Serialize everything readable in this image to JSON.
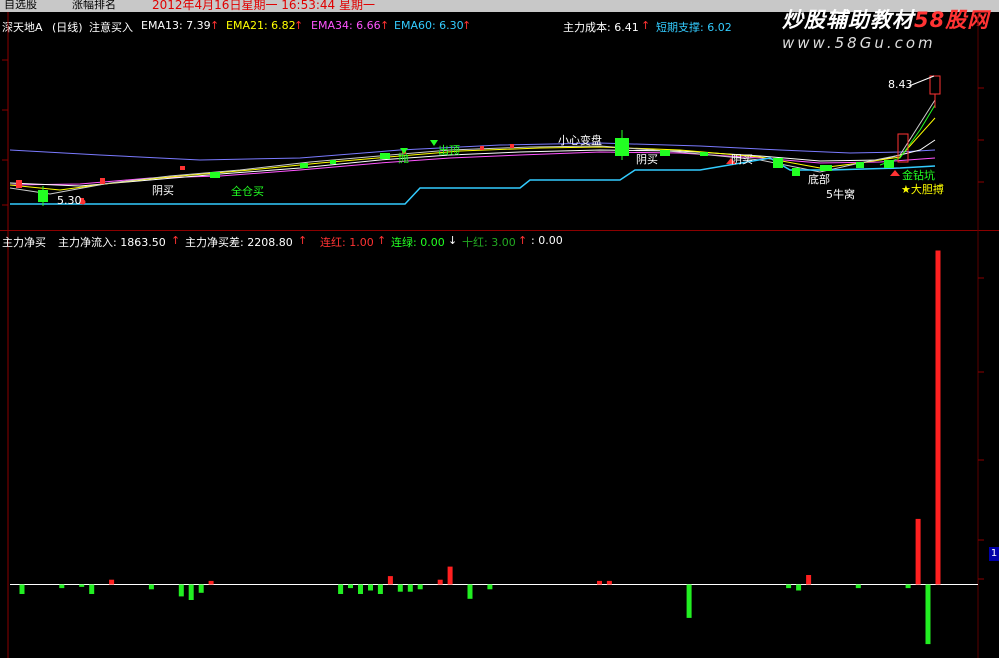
{
  "topbar": {
    "tab1": "自选股",
    "tab2": "涨幅排名",
    "datetime": "2012年4月16日星期一 16:53:44 星期一"
  },
  "watermark": {
    "line1_a": "炒股辅助教材",
    "line1_b": "58股网",
    "line2": "www.58Gu.com"
  },
  "indicator_bar": {
    "title": "深天地A",
    "period": "(日线)",
    "formula": "注意买入",
    "ema13": "EMA13: 7.39",
    "ema21": "EMA21: 6.82",
    "ema34": "EMA34: 6.66",
    "ema60": "EMA60: 6.30",
    "cost": "主力成本: 6.41",
    "support": "短期支撑: 6.02",
    "colors": {
      "ema13": "#ffffff",
      "ema21": "#ffff00",
      "ema34": "#ff55ff",
      "ema60": "#33ccff",
      "cost": "#ffffff",
      "support": "#33ccff"
    }
  },
  "price_chart": {
    "high_label": "8.43",
    "low_label": "5.30",
    "annotations": {
      "sell_top1": "抛",
      "sell_top2": "出顶",
      "caution": "小心变盘",
      "yin_buy1": "阴买",
      "full_buy": "全仓买",
      "yin_buy2": "阴买",
      "yin_buy3": "阴买",
      "bottom": "底部",
      "golden_pit": "5牛窝",
      "gold_pit": "金钻坑",
      "bold_fight": "★大胆搏"
    }
  },
  "flow_bar": {
    "title": "主力净买",
    "inflow": "主力净流入: 1863.50",
    "net_buy": "主力净买差: 2208.80",
    "streak_red": "连红: 1.00",
    "streak_green": "连绿: 0.00",
    "ten_red": "十红: 3.00",
    "extra": ": 0.00"
  },
  "right_axis": {
    "marker": "1"
  },
  "chart_data": {
    "type": "bar",
    "series": [
      {
        "name": "主力净买",
        "values": [
          0,
          -8,
          0,
          0,
          0,
          -3,
          0,
          -2,
          -8,
          0,
          4,
          0,
          0,
          0,
          -4,
          0,
          0,
          -10,
          -13,
          -7,
          3,
          0,
          0,
          0,
          0,
          0,
          0,
          0,
          0,
          0,
          0,
          0,
          0,
          -8,
          -3,
          -8,
          -5,
          -8,
          7,
          -6,
          -6,
          -4,
          0,
          4,
          15,
          0,
          -12,
          0,
          -4,
          0,
          0,
          0,
          0,
          0,
          0,
          0,
          0,
          0,
          0,
          3,
          3,
          0,
          0,
          0,
          0,
          0,
          0,
          0,
          -28,
          0,
          0,
          0,
          0,
          0,
          0,
          0,
          0,
          0,
          -3,
          -5,
          8,
          0,
          0,
          0,
          0,
          -3,
          0,
          0,
          0,
          0,
          -3,
          55,
          -50,
          280
        ]
      }
    ]
  }
}
